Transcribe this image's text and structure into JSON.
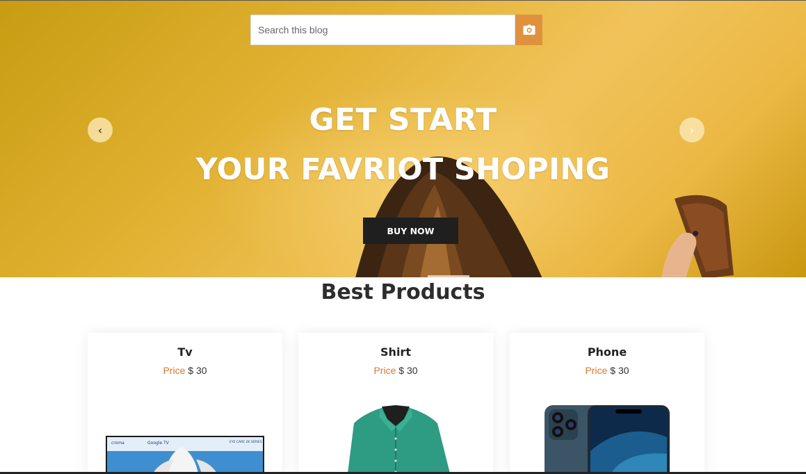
{
  "search": {
    "placeholder": "Search this blog",
    "icon": "camera-icon"
  },
  "hero": {
    "title_line1": "GET START",
    "title_line2": "YOUR FAVRIOT SHOPING",
    "buy_label": "BUY NOW",
    "prev_icon": "‹",
    "next_icon": "›",
    "background_color": "#e2b233"
  },
  "products_section": {
    "title": "Best Products",
    "price_label": "Price",
    "items": [
      {
        "name": "Tv",
        "price": "$ 30",
        "image": "tv-image",
        "tv_text": "croma",
        "tv_badge": "Google TV",
        "tv_model": "EYE CARE 2K SERIES"
      },
      {
        "name": "Shirt",
        "price": "$ 30",
        "image": "shirt-image"
      },
      {
        "name": "Phone",
        "price": "$ 30",
        "image": "phone-image"
      }
    ]
  },
  "colors": {
    "accent": "#e0913e",
    "price_label": "#d9782d",
    "button_dark": "#1f1f1f"
  }
}
